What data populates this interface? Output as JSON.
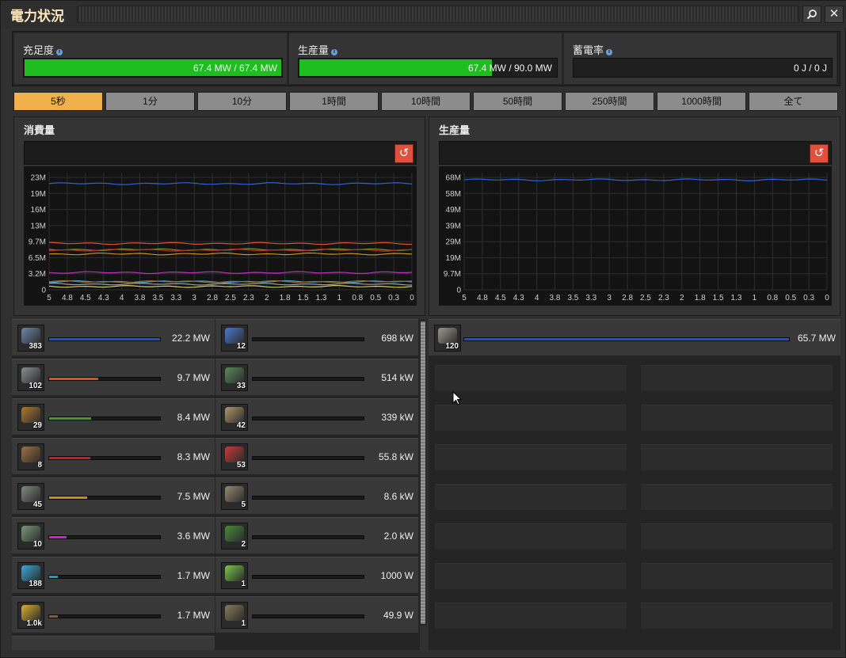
{
  "window": {
    "title": "電力状況",
    "search_icon": "magnifier-icon",
    "close_icon": "close-icon"
  },
  "stats": [
    {
      "label": "充足度",
      "value": "67.4 MW / 67.4 MW",
      "fill": 1.0
    },
    {
      "label": "生産量",
      "value": "67.4 MW / 90.0 MW",
      "fill": 0.749
    },
    {
      "label": "蓄電率",
      "value": "0 J / 0 J",
      "fill": 0.0
    }
  ],
  "tabs": [
    {
      "label": "5秒",
      "active": true
    },
    {
      "label": "1分",
      "active": false
    },
    {
      "label": "10分",
      "active": false
    },
    {
      "label": "1時間",
      "active": false
    },
    {
      "label": "10時間",
      "active": false
    },
    {
      "label": "50時間",
      "active": false
    },
    {
      "label": "250時間",
      "active": false
    },
    {
      "label": "1000時間",
      "active": false
    },
    {
      "label": "全て",
      "active": false
    }
  ],
  "consumption": {
    "title": "消費量",
    "chart_data": {
      "type": "line",
      "x_ticks": [
        "5",
        "4.8",
        "4.5",
        "4.3",
        "4",
        "3.8",
        "3.5",
        "3.3",
        "3",
        "2.8",
        "2.5",
        "2.3",
        "2",
        "1.8",
        "1.5",
        "1.3",
        "1",
        "0.8",
        "0.5",
        "0.3",
        "0"
      ],
      "y_ticks": [
        "0",
        "3.2M",
        "6.5M",
        "9.7M",
        "13M",
        "16M",
        "19M",
        "23M"
      ],
      "ylim": [
        0,
        24.5
      ],
      "series": [
        {
          "color": "#2f63d8",
          "value": 22.2
        },
        {
          "color": "#e0502a",
          "value": 9.7
        },
        {
          "color": "#6a9a2a",
          "value": 8.4
        },
        {
          "color": "#c02a2a",
          "value": 8.3
        },
        {
          "color": "#c8901e",
          "value": 7.5
        },
        {
          "color": "#c030c0",
          "value": 3.6
        },
        {
          "color": "#3aa0c8",
          "value": 1.7
        },
        {
          "color": "#9a6a3a",
          "value": 1.7
        },
        {
          "color": "#9aa0a0",
          "value": 1.2
        },
        {
          "color": "#cfcf6a",
          "value": 0.7
        }
      ]
    }
  },
  "production": {
    "title": "生産量",
    "chart_data": {
      "type": "line",
      "x_ticks": [
        "5",
        "4.8",
        "4.5",
        "4.3",
        "4",
        "3.8",
        "3.5",
        "3.3",
        "3",
        "2.8",
        "2.5",
        "2.3",
        "2",
        "1.8",
        "1.5",
        "1.3",
        "1",
        "0.8",
        "0.5",
        "0.3",
        "0"
      ],
      "y_ticks": [
        "0",
        "9.7M",
        "19M",
        "29M",
        "39M",
        "49M",
        "58M",
        "68M"
      ],
      "ylim": [
        0,
        70
      ],
      "series": [
        {
          "color": "#2f63d8",
          "value": 65.7
        }
      ]
    }
  },
  "consumers_left": [
    {
      "icon": "assembler-icon",
      "count": "383",
      "value": "22.2 MW",
      "fill": 1.0,
      "color": "#1c52c8",
      "icon_color": "#6e86a8"
    },
    {
      "icon": "gears-machine-icon",
      "count": "102",
      "value": "9.7 MW",
      "fill": 0.44,
      "color": "#e05018",
      "icon_color": "#8a8f96"
    },
    {
      "icon": "furnace-robot-icon",
      "count": "29",
      "value": "8.4 MW",
      "fill": 0.38,
      "color": "#4f9a18",
      "icon_color": "#b07a30"
    },
    {
      "icon": "lab-robot-icon",
      "count": "8",
      "value": "8.3 MW",
      "fill": 0.37,
      "color": "#c81e1e",
      "icon_color": "#a07040"
    },
    {
      "icon": "refinery-icon",
      "count": "45",
      "value": "7.5 MW",
      "fill": 0.34,
      "color": "#c8901a",
      "icon_color": "#7f8a80"
    },
    {
      "icon": "chem-plant-icon",
      "count": "10",
      "value": "3.6 MW",
      "fill": 0.16,
      "color": "#d020c8",
      "icon_color": "#7a9a7a"
    },
    {
      "icon": "inserter-blue-icon",
      "count": "188",
      "value": "1.7 MW",
      "fill": 0.08,
      "color": "#18a0c8",
      "icon_color": "#3aa8d8"
    },
    {
      "icon": "inserter-yellow-icon",
      "count": "1.0k",
      "value": "1.7 MW",
      "fill": 0.08,
      "color": "#8a5a2a",
      "icon_color": "#d8b030"
    }
  ],
  "consumers_right": [
    {
      "icon": "beacon-icon",
      "count": "12",
      "value": "698 kW",
      "fill": 0.0,
      "color": "#777",
      "icon_color": "#4a7acc"
    },
    {
      "icon": "pump-icon",
      "count": "33",
      "value": "514 kW",
      "fill": 0.0,
      "color": "#777",
      "icon_color": "#5a8a5a"
    },
    {
      "icon": "roboport-icon",
      "count": "42",
      "value": "339 kW",
      "fill": 0.0,
      "color": "#777",
      "icon_color": "#b0986a"
    },
    {
      "icon": "inserter-red-icon",
      "count": "53",
      "value": "55.8 kW",
      "fill": 0.0,
      "color": "#777",
      "icon_color": "#c83a3a"
    },
    {
      "icon": "radar-icon",
      "count": "5",
      "value": "8.6 kW",
      "fill": 0.0,
      "color": "#777",
      "icon_color": "#9a8a70"
    },
    {
      "icon": "combinator-icon",
      "count": "2",
      "value": "2.0 kW",
      "fill": 0.0,
      "color": "#777",
      "icon_color": "#4a8a3a"
    },
    {
      "icon": "inserter-green-icon",
      "count": "1",
      "value": "1000 W",
      "fill": 0.0,
      "color": "#777",
      "icon_color": "#7ac84a"
    },
    {
      "icon": "lamp-icon",
      "count": "1",
      "value": "49.9 W",
      "fill": 0.0,
      "color": "#777",
      "icon_color": "#8a7a5a"
    }
  ],
  "producers": [
    {
      "icon": "steam-engine-icon",
      "count": "120",
      "value": "65.7 MW",
      "fill": 1.0,
      "color": "#1c52c8",
      "icon_color": "#9a9a8a"
    }
  ]
}
